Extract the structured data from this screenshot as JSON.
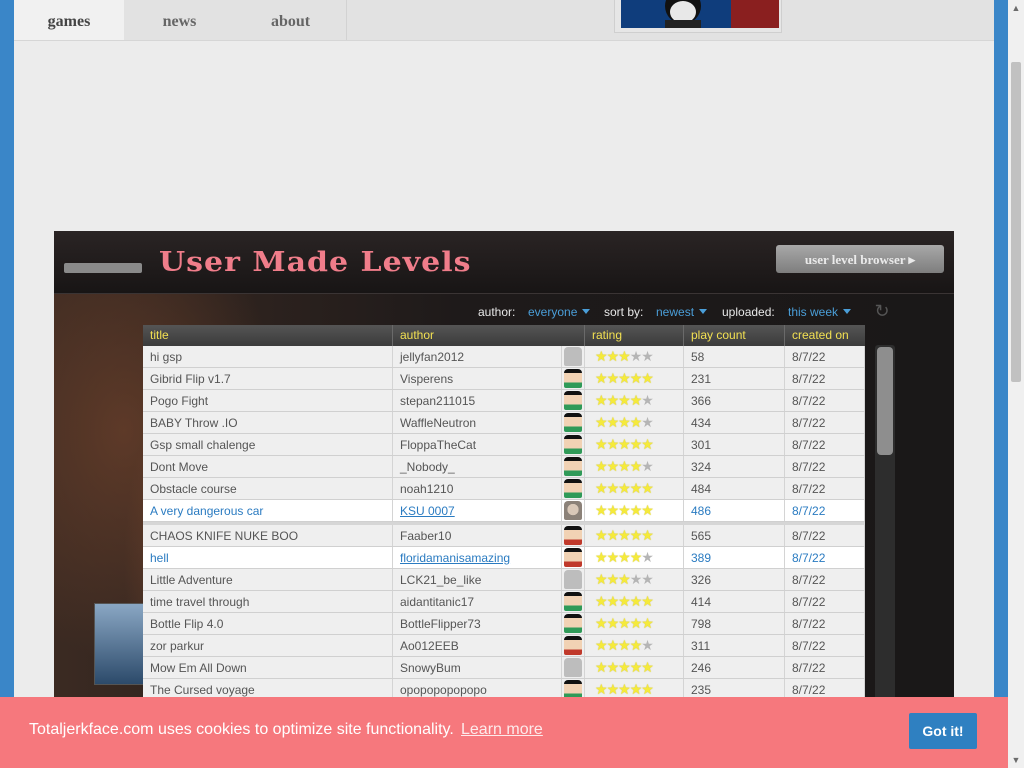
{
  "nav": {
    "tabs": [
      {
        "label": "games"
      },
      {
        "label": "news"
      },
      {
        "label": "about"
      }
    ],
    "active": "games"
  },
  "game": {
    "title": "User Made Levels",
    "browser_button": "user level browser ▸",
    "filters": {
      "author_label": "author:",
      "author_value": "everyone",
      "sort_label": "sort by:",
      "sort_value": "newest",
      "uploaded_label": "uploaded:",
      "uploaded_value": "this week"
    },
    "columns": [
      "title",
      "author",
      "rating",
      "play count",
      "created on"
    ],
    "rows": [
      {
        "title": "hi gsp",
        "author": "jellyfan2012",
        "rating": 3,
        "plays": "58",
        "date": "8/7/22",
        "face": "blank"
      },
      {
        "title": "Gibrid Flip v1.7",
        "author": "Visperens",
        "rating": 5,
        "plays": "231",
        "date": "8/7/22",
        "face": "player"
      },
      {
        "title": "Pogo Fight",
        "author": "stepan211015",
        "rating": 4,
        "plays": "366",
        "date": "8/7/22",
        "face": "player"
      },
      {
        "title": "BABY Throw .IO",
        "author": "WaffleNeutron",
        "rating": 4,
        "plays": "434",
        "date": "8/7/22",
        "face": "player"
      },
      {
        "title": "Gsp small chalenge",
        "author": "FloppaTheCat",
        "rating": 5,
        "plays": "301",
        "date": "8/7/22",
        "face": "player"
      },
      {
        "title": "Dont Move",
        "author": "_Nobody_",
        "rating": 4,
        "plays": "324",
        "date": "8/7/22",
        "face": "player"
      },
      {
        "title": "Obstacle course",
        "author": "noah1210",
        "rating": 5,
        "plays": "484",
        "date": "8/7/22",
        "face": "player"
      },
      {
        "title": "A very dangerous car",
        "author": "KSU 0007",
        "rating": 5,
        "plays": "486",
        "date": "8/7/22",
        "face": "photo",
        "highlight": true
      },
      {
        "title": "CHAOS KNIFE NUKE BOO",
        "author": "Faaber10",
        "rating": 5,
        "plays": "565",
        "date": "8/7/22",
        "face": "player red"
      },
      {
        "title": "hell",
        "author": "floridamanisamazing",
        "rating": 4,
        "plays": "389",
        "date": "8/7/22",
        "face": "player red",
        "highlight": true
      },
      {
        "title": "Little Adventure",
        "author": "LCK21_be_like",
        "rating": 3,
        "plays": "326",
        "date": "8/7/22",
        "face": "blank"
      },
      {
        "title": "time travel through",
        "author": "aidantitanic17",
        "rating": 5,
        "plays": "414",
        "date": "8/7/22",
        "face": "player"
      },
      {
        "title": "Bottle Flip 4.0",
        "author": "BottleFlipper73",
        "rating": 5,
        "plays": "798",
        "date": "8/7/22",
        "face": "player"
      },
      {
        "title": "zor parkur",
        "author": "Ao012EEB",
        "rating": 4,
        "plays": "311",
        "date": "8/7/22",
        "face": "player red"
      },
      {
        "title": "Mow Em All Down",
        "author": "SnowyBum",
        "rating": 5,
        "plays": "246",
        "date": "8/7/22",
        "face": "blank"
      },
      {
        "title": "The Cursed voyage",
        "author": "opopopopopopo",
        "rating": 5,
        "plays": "235",
        "date": "8/7/22",
        "face": "player"
      }
    ]
  },
  "cookie": {
    "text": "Totaljerkface.com uses cookies to optimize site functionality.",
    "link": "Learn more",
    "button": "Got it!"
  },
  "icons": {
    "refresh": "refresh-icon",
    "caret": "caret-down-icon",
    "scroll_up": "scroll-up-icon",
    "scroll_down": "scroll-down-icon"
  }
}
